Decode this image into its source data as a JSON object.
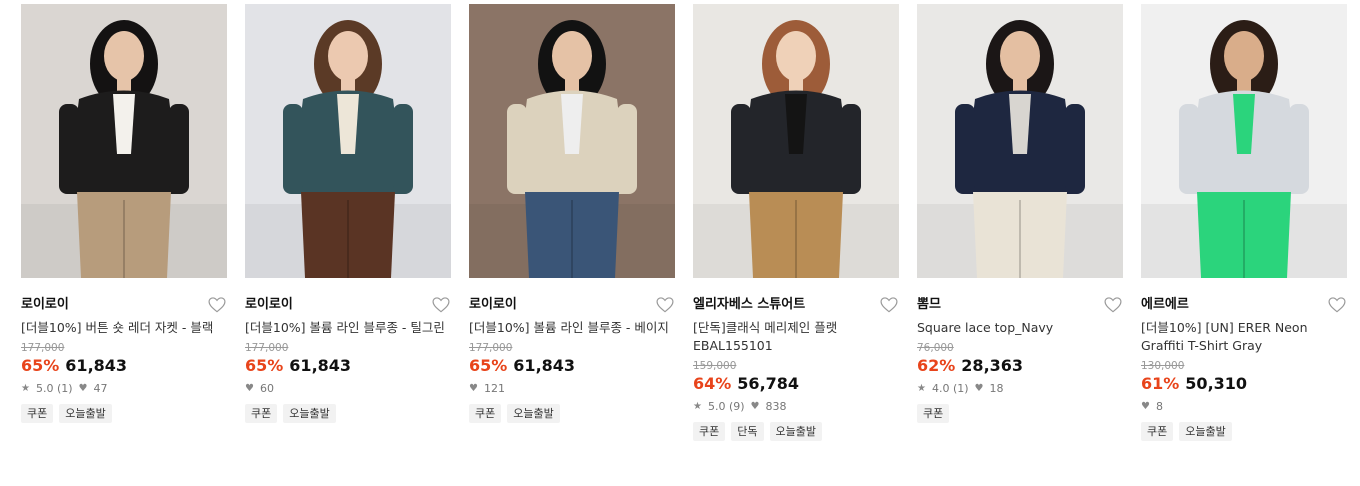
{
  "products": [
    {
      "brand": "로이로이",
      "title": "[더블10%] 버튼 숏 레더 자켓 - 블랙",
      "original_price": "177,000",
      "discount": "65%",
      "price": "61,843",
      "rating": "5.0 (1)",
      "likes": "47",
      "tags": [
        "쿠폰",
        "오늘출발"
      ],
      "photo": {
        "bg": "#dad6d2",
        "top": "#1d1c1c",
        "bottom": "#b79c7c",
        "skin": "#e6c4a9",
        "hair": "#141212",
        "accent": "#f3f1ec"
      }
    },
    {
      "brand": "로이로이",
      "title": "[더블10%] 볼륨 라인 블루종 - 틸그린",
      "original_price": "177,000",
      "discount": "65%",
      "price": "61,843",
      "rating": "",
      "likes": "60",
      "tags": [
        "쿠폰",
        "오늘출발"
      ],
      "photo": {
        "bg": "#e2e3e7",
        "top": "#33545b",
        "bottom": "#5a3424",
        "skin": "#ecc9b0",
        "hair": "#5b3a26",
        "accent": "#ede6d8"
      }
    },
    {
      "brand": "로이로이",
      "title": "[더블10%] 볼륨 라인 블루종 - 베이지",
      "original_price": "177,000",
      "discount": "65%",
      "price": "61,843",
      "rating": "",
      "likes": "121",
      "tags": [
        "쿠폰",
        "오늘출발"
      ],
      "photo": {
        "bg": "#8b7466",
        "top": "#dcd2bd",
        "bottom": "#3a5577",
        "skin": "#e5c2a6",
        "hair": "#121212",
        "accent": "#eeeeee"
      }
    },
    {
      "brand": "엘리자베스 스튜어트",
      "title": "[단독]클래식 메리제인 플랫 EBAL155101",
      "original_price": "159,000",
      "discount": "64%",
      "price": "56,784",
      "rating": "5.0 (9)",
      "likes": "838",
      "tags": [
        "쿠폰",
        "단독",
        "오늘출발"
      ],
      "photo": {
        "bg": "#e9e7e3",
        "top": "#23252a",
        "bottom": "#b98d55",
        "skin": "#efd1b8",
        "hair": "#9d5c39",
        "accent": "#141414"
      }
    },
    {
      "brand": "뽐므",
      "title": "Square lace top_Navy",
      "original_price": "76,000",
      "discount": "62%",
      "price": "28,363",
      "rating": "4.0 (1)",
      "likes": "18",
      "tags": [
        "쿠폰"
      ],
      "photo": {
        "bg": "#e9e8e6",
        "top": "#1e2740",
        "bottom": "#e9e3d6",
        "skin": "#e4bfa2",
        "hair": "#1b1616",
        "accent": "#d8d5d0"
      }
    },
    {
      "brand": "에르에르",
      "title": "[더블10%] [UN] ERER Neon Graffiti T-Shirt Gray",
      "original_price": "130,000",
      "discount": "61%",
      "price": "50,310",
      "rating": "",
      "likes": "8",
      "tags": [
        "쿠폰",
        "오늘출발"
      ],
      "photo": {
        "bg": "#f0f0f0",
        "top": "#d5d9de",
        "bottom": "#2bd47c",
        "skin": "#d9ad8a",
        "hair": "#2b1d16",
        "accent": "#2bd47c"
      }
    }
  ]
}
